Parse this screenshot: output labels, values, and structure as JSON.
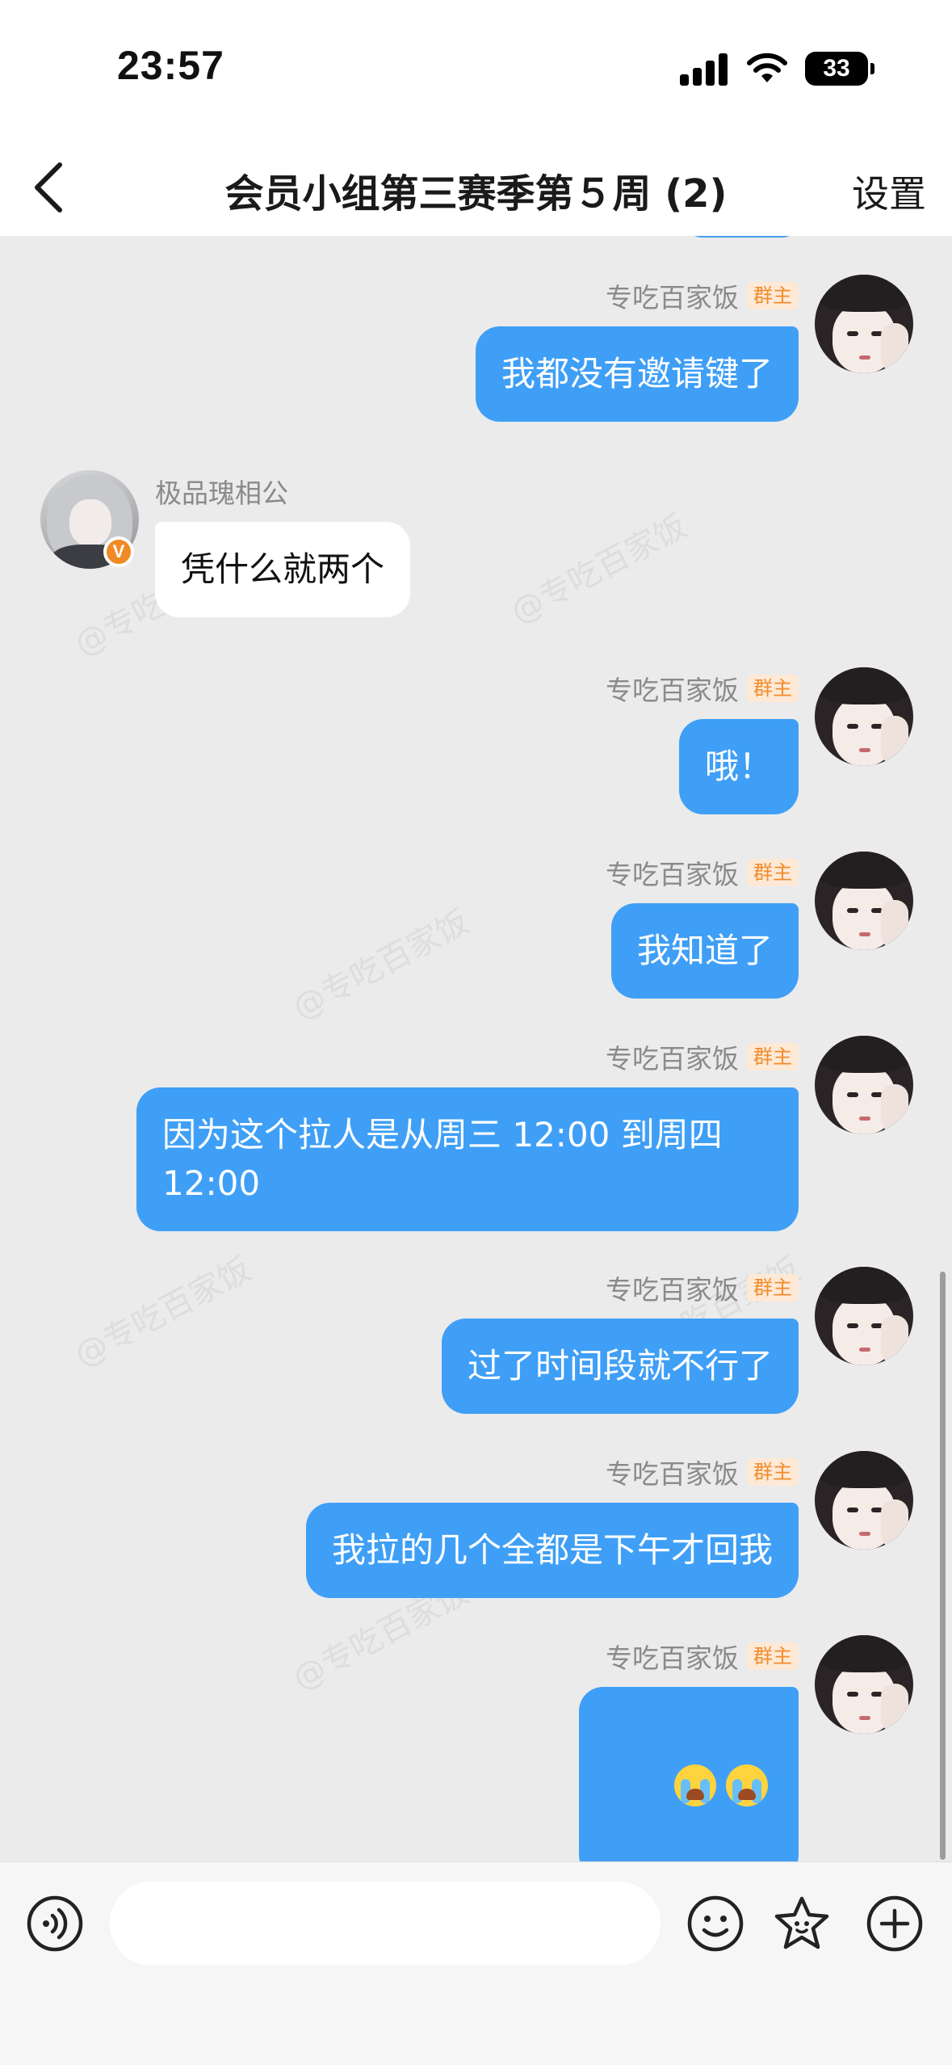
{
  "status_bar": {
    "time": "23:57",
    "battery": "33",
    "signal_icon": "cellular-signal-icon",
    "wifi_icon": "wifi-icon"
  },
  "nav": {
    "title": "会员小组第三赛季第５周 (2)",
    "settings_label": "设置",
    "back_icon": "chevron-left-icon"
  },
  "watermark_text": "@专吃百家饭",
  "colors": {
    "self_bubble": "#3f9ff6",
    "other_bubble": "#ffffff",
    "chat_background": "#ebebeb",
    "owner_badge_text": "#f28b2c",
    "vip_badge": "#f08a24"
  },
  "messages": [
    {
      "side": "self",
      "sender": "专吃百家饭",
      "badge": "群主",
      "text": "我都没有邀请键了"
    },
    {
      "side": "other",
      "sender": "极品瑰相公",
      "badge_icon": "vip-v-icon",
      "text": "凭什么就两个"
    },
    {
      "side": "self",
      "sender": "专吃百家饭",
      "badge": "群主",
      "text": "哦！"
    },
    {
      "side": "self",
      "sender": "专吃百家饭",
      "badge": "群主",
      "text": "我知道了"
    },
    {
      "side": "self",
      "sender": "专吃百家饭",
      "badge": "群主",
      "text": "因为这个拉人是从周三 12:00 到周四\n12:00"
    },
    {
      "side": "self",
      "sender": "专吃百家饭",
      "badge": "群主",
      "text": "过了时间段就不行了"
    },
    {
      "side": "self",
      "sender": "专吃百家饭",
      "badge": "群主",
      "text": "我拉的几个全都是下午才回我"
    },
    {
      "side": "self",
      "sender": "专吃百家饭",
      "badge": "群主",
      "emoji": [
        "loudly-crying-emoji",
        "loudly-crying-emoji"
      ]
    }
  ],
  "input_bar": {
    "placeholder": "",
    "voice_icon": "voice-icon",
    "emoji_icon": "smiley-icon",
    "sticker_icon": "star-sticker-icon",
    "plus_icon": "plus-circle-icon"
  }
}
